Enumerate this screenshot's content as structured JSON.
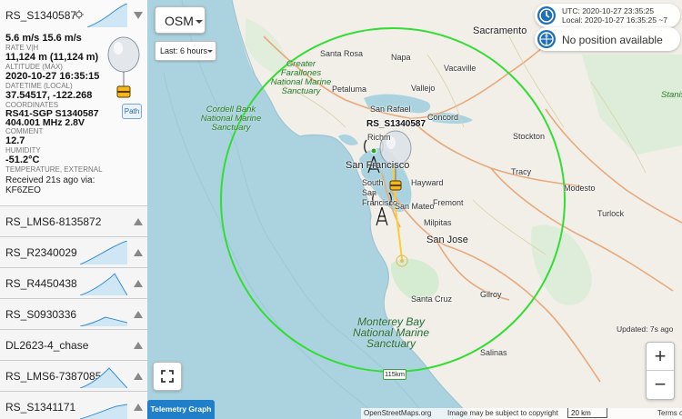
{
  "map": {
    "layer_button": "OSM",
    "range_button": "Last: 6 hours",
    "balloon_label": "RS_S1340587",
    "radius_label": "115km",
    "labels": {
      "sacramento": "Sacramento",
      "santa_rosa": "Santa Rosa",
      "napa": "Napa",
      "vacaville": "Vacaville",
      "petaluma": "Petaluma",
      "vallejo": "Vallejo",
      "concord": "Concord",
      "san_rafael": "San Rafael",
      "richmond": "Richm",
      "san_francisco": "San Francisco",
      "south_san_francisco": "South San Francisco",
      "hayward": "Hayward",
      "tracy": "Tracy",
      "stockton": "Stockton",
      "modesto": "Modesto",
      "turlock": "Turlock",
      "fremont": "Fremont",
      "milpitas": "Milpitas",
      "san_jose": "San Jose",
      "san_mateo": "San Mateo",
      "santa_cruz": "Santa Cruz",
      "gilroy": "Gilroy",
      "salinas": "Salinas",
      "stanislaus": "Stanis National",
      "greater_farallones": "Greater Farallones National Marine Sanctuary",
      "cordell_bank": "Cordell Bank National Marine Sanctuary",
      "monterey_bay": "Monterey Bay National Marine Sanctuary"
    }
  },
  "time": {
    "utc": "UTC: 2020-10-27 23:35:25",
    "local": "Local: 2020-10-27 16:35:25 ~7"
  },
  "position": {
    "text": "No position available"
  },
  "updated": "Updated: 7s ago",
  "telemetry_tab": "Telemetry Graph",
  "attribution": {
    "osm": "OpenStreetMaps.org",
    "copyright": "Image may be subject to copyright",
    "scale": "20 km",
    "terms": "Terms of Use"
  },
  "sidebar": {
    "active": {
      "name": "RS_S1340587",
      "speed": "5.6 m/s 15.6 m/s",
      "rate_key": "RATE V|H",
      "altitude": "11,124 m (11,124 m)",
      "altitude_key": "ALTITUDE (MAX)",
      "datetime": "2020-10-27 16:35:15",
      "datetime_key": "DATETIME (LOCAL)",
      "coords": "37.54517, -122.268",
      "coords_key": "COORDINATES",
      "comment": "RS41-SGP S1340587 404.001 MHz 2.8V",
      "comment_key": "COMMENT",
      "humidity": "12.7",
      "humidity_key": "HUMIDITY",
      "temperature": "-51.2°C",
      "temperature_key": "TEMPERATURE, EXTERNAL",
      "received": "Received 21s ago via:",
      "receiver": "KF6ZEO",
      "path_button": "Path"
    },
    "items": [
      {
        "name": "RS_LMS6-8135872"
      },
      {
        "name": "RS_R2340029"
      },
      {
        "name": "RS_R4450438"
      },
      {
        "name": "RS_S0930336"
      },
      {
        "name": "DL2623-4_chase"
      },
      {
        "name": "RS_LMS6-7387085"
      },
      {
        "name": "RS_S1341171"
      }
    ]
  },
  "colors": {
    "range_circle": "#33dd33",
    "accent": "#1f7fc9",
    "sea": "#aad3df",
    "land": "#f2efe9"
  }
}
